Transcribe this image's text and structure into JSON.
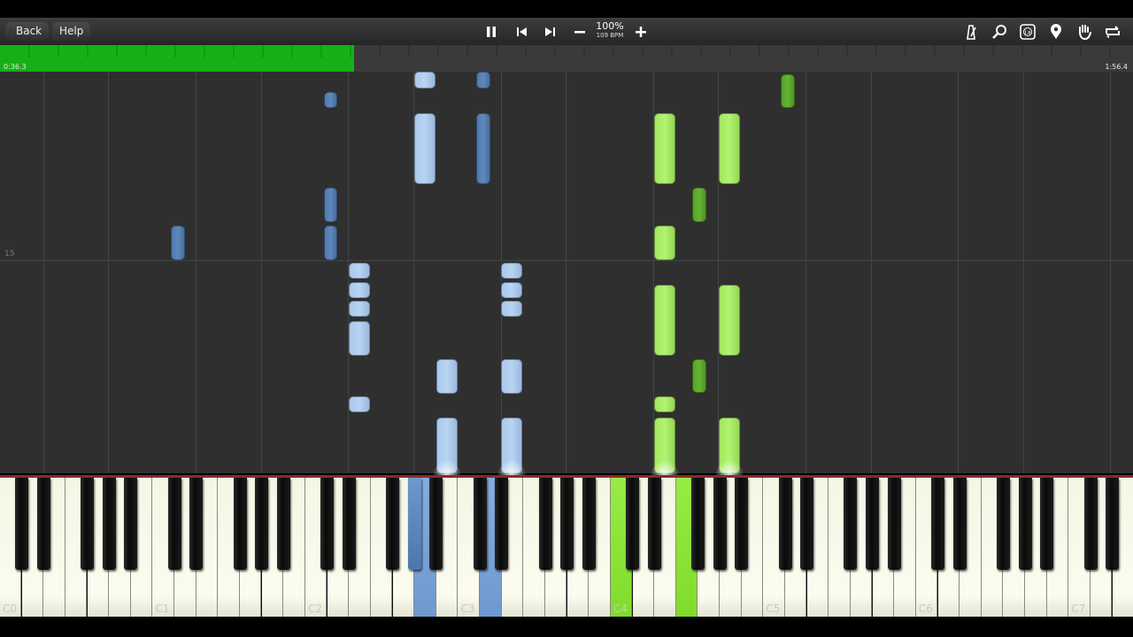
{
  "toolbar": {
    "back_label": "Back",
    "help_label": "Help",
    "speed_percent": "100%",
    "speed_bpm": "109 BPM",
    "icons": [
      "pause-icon",
      "skip-back-icon",
      "skip-forward-icon",
      "minus-icon",
      "plus-icon",
      "metronome-icon",
      "search-icon",
      "note-label-icon",
      "location-pin-icon",
      "hand-icon",
      "loop-icon"
    ]
  },
  "progress": {
    "current_time": "0:36.3",
    "total_time": "1:56.4",
    "fraction": 0.3125,
    "color": "#16b016"
  },
  "roll": {
    "measure_number": "15"
  },
  "keyboard": {
    "octave_labels": [
      "C0",
      "C1",
      "C2",
      "C3",
      "C4",
      "C5",
      "C6",
      "C7"
    ],
    "left_hand_color": "#86aedd",
    "right_hand_color": "#98ec44",
    "pressed_white_keys": [
      {
        "key": "A2",
        "hand": "left"
      },
      {
        "key": "D3",
        "hand": "left"
      },
      {
        "key": "C4",
        "hand": "right"
      },
      {
        "key": "F4",
        "hand": "right"
      }
    ],
    "pressed_black_keys": [
      {
        "key": "G#2",
        "hand": "left"
      }
    ]
  }
}
